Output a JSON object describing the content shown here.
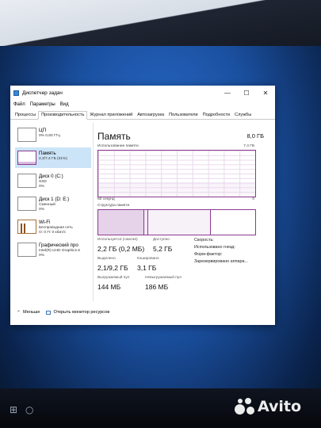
{
  "window": {
    "title": "Диспетчер задач",
    "controls": {
      "minimize": "—",
      "maximize": "☐",
      "close": "✕"
    }
  },
  "menu": [
    "Файл",
    "Параметры",
    "Вид"
  ],
  "tabs": [
    {
      "label": "Процессы"
    },
    {
      "label": "Производительность"
    },
    {
      "label": "Журнал приложений"
    },
    {
      "label": "Автозагрузка"
    },
    {
      "label": "Пользователи"
    },
    {
      "label": "Подробности"
    },
    {
      "label": "Службы"
    }
  ],
  "active_tab": "Производительность",
  "sidebar": {
    "items": [
      {
        "title": "ЦП",
        "sub1": "0% 0,83 ГГц",
        "sub2": "",
        "sub3": ""
      },
      {
        "title": "Память",
        "sub1": "2,3/7,4 ГБ (31%)",
        "sub2": "",
        "sub3": ""
      },
      {
        "title": "Диск 0 (C:)",
        "sub1": "SSD",
        "sub2": "0%",
        "sub3": ""
      },
      {
        "title": "Диск 1 (D: E:)",
        "sub1": "Сменный",
        "sub2": "0%",
        "sub3": ""
      },
      {
        "title": "Wi-Fi",
        "sub1": "Беспроводная сеть",
        "sub2": "О: 0 П: 0 кбит/с",
        "sub3": ""
      },
      {
        "title": "Графический про",
        "sub1": "Intel(R) UHD Graphics 6",
        "sub2": "0%",
        "sub3": ""
      }
    ],
    "selected_index": 1
  },
  "main": {
    "title": "Память",
    "total": "8,0 ГБ",
    "usage_label": "Использование памяти",
    "usage_max": "7,4 ГБ",
    "axis_left": "60 секунд",
    "axis_right": "0",
    "composition_label": "Структура памяти",
    "usage_fraction": 0.31
  },
  "stats": {
    "in_use_label": "Используется (сжатая)",
    "in_use_value": "2,2 ГБ (0,2 МБ)",
    "available_label": "Доступно",
    "available_value": "5,2 ГБ",
    "committed_label": "Выделено",
    "committed_value": "2,1/9,2 ГБ",
    "cached_label": "Кэшировано",
    "cached_value": "3,1 ГБ",
    "paged_label": "Выгружаемый пул",
    "paged_value": "144 МБ",
    "nonpaged_label": "Невыгружаемый пул",
    "nonpaged_value": "186 МБ",
    "speed_label": "Скорость:",
    "slots_label": "Использовано гнезд:",
    "form_label": "Форм-фактор:",
    "reserved_label": "Зарезервировано аппара..."
  },
  "footer": {
    "less": "Меньше",
    "monitor": "Открыть монитор ресурсов"
  },
  "watermark": "Avito",
  "colors": {
    "memory_accent": "#8b3a8f",
    "selected_bg": "#cce4f7",
    "desktop_blue": "#1a4f9e"
  }
}
